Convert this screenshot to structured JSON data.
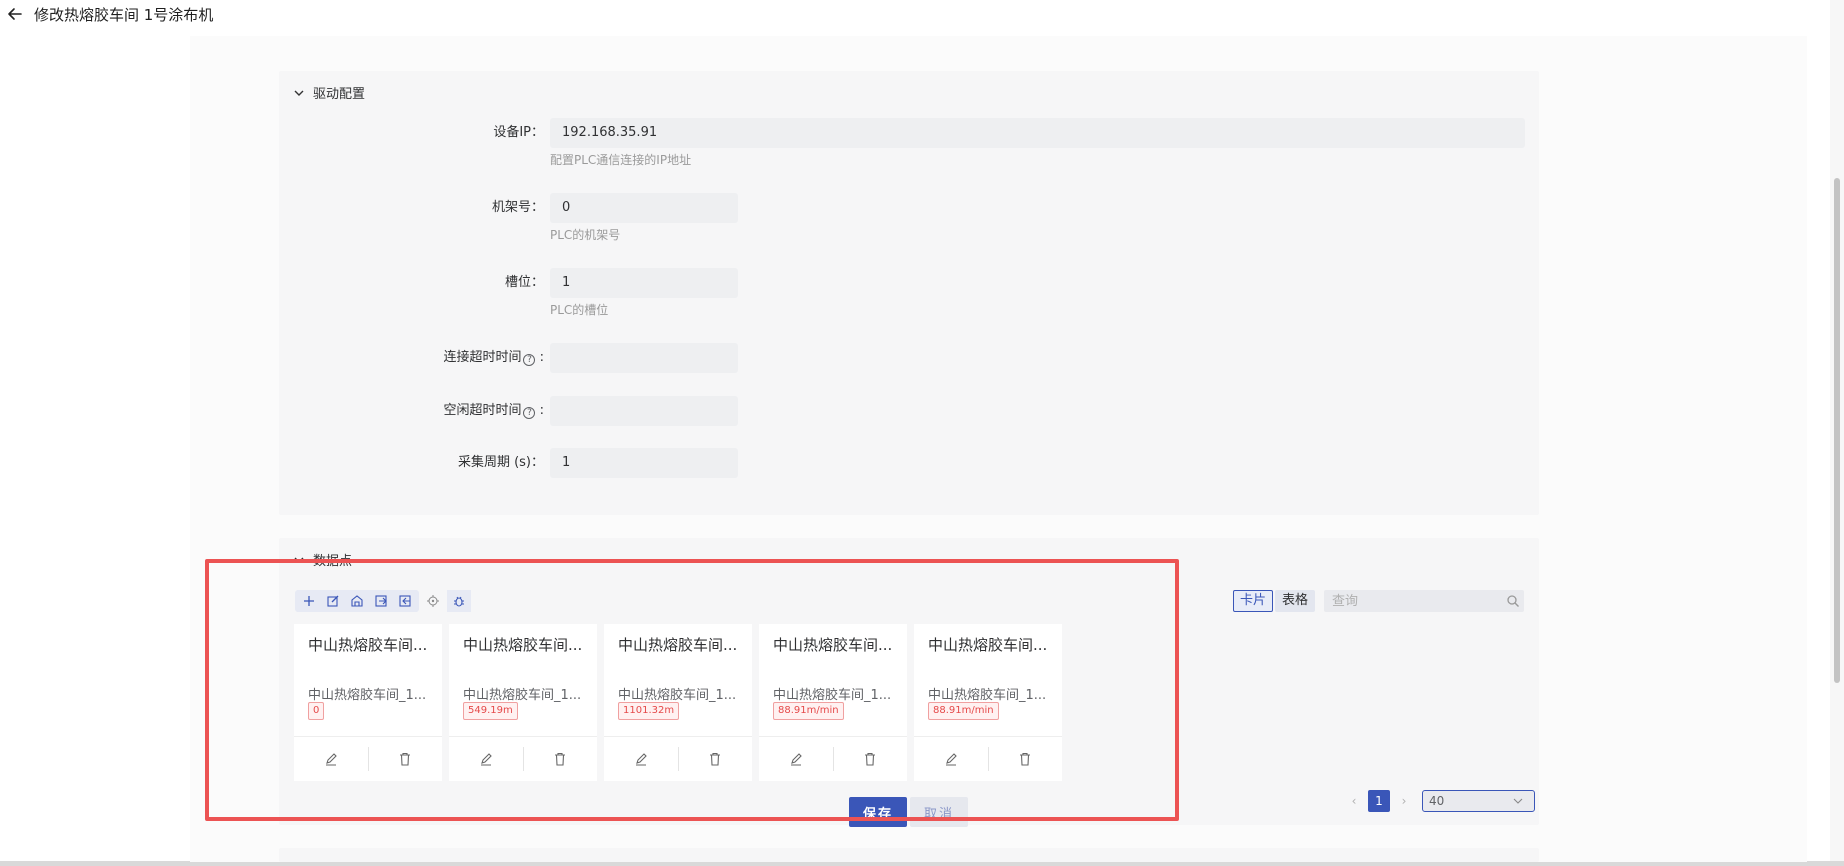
{
  "header": {
    "title": "修改热熔胶车间 1号涂布机"
  },
  "driver_section": {
    "title": "驱动配置",
    "fields": [
      {
        "label": "设备IP：",
        "value": "192.168.35.91",
        "help": "配置PLC通信连接的IP地址"
      },
      {
        "label": "机架号：",
        "value": "0",
        "help": "PLC的机架号"
      },
      {
        "label": "槽位：",
        "value": "1",
        "help": "PLC的槽位"
      },
      {
        "label": "连接超时时间",
        "value": "",
        "help": ""
      },
      {
        "label": "空闲超时时间",
        "value": "",
        "help": ""
      },
      {
        "label": "采集周期 (s)：",
        "value": "1",
        "help": ""
      }
    ]
  },
  "points_section": {
    "title": "数据点",
    "view_toggle": {
      "card": "卡片",
      "table": "表格"
    },
    "search_placeholder": "查询",
    "cards": [
      {
        "title": "中山热熔胶车间...",
        "subtitle": "中山热熔胶车间_1...",
        "tag": "0"
      },
      {
        "title": "中山热熔胶车间...",
        "subtitle": "中山热熔胶车间_1...",
        "tag": "549.19m"
      },
      {
        "title": "中山热熔胶车间...",
        "subtitle": "中山热熔胶车间_1...",
        "tag": "1101.32m"
      },
      {
        "title": "中山热熔胶车间...",
        "subtitle": "中山热熔胶车间_1...",
        "tag": "88.91m/min"
      },
      {
        "title": "中山热熔胶车间...",
        "subtitle": "中山热熔胶车间_1...",
        "tag": "88.91m/min"
      }
    ],
    "pagination": {
      "current_page": "1",
      "page_size": "40"
    }
  },
  "footer": {
    "save_label": "保存",
    "cancel_label": "取消"
  },
  "colors": {
    "primary": "#3a56b8",
    "highlight": "#ec5353",
    "tag_red": "#e54a4a"
  }
}
